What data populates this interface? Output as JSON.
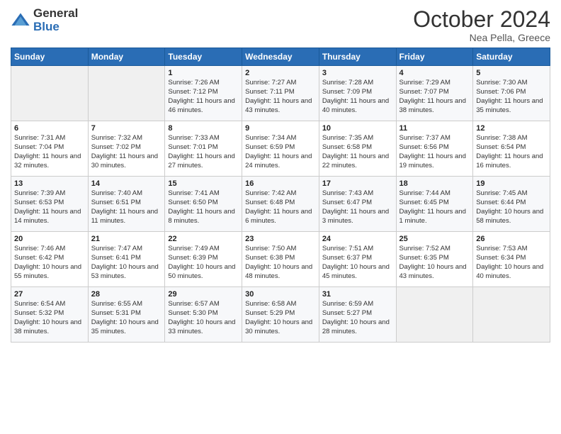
{
  "logo": {
    "general": "General",
    "blue": "Blue"
  },
  "title": "October 2024",
  "subtitle": "Nea Pella, Greece",
  "days_header": [
    "Sunday",
    "Monday",
    "Tuesday",
    "Wednesday",
    "Thursday",
    "Friday",
    "Saturday"
  ],
  "weeks": [
    [
      {
        "day": "",
        "sunrise": "",
        "sunset": "",
        "daylight": ""
      },
      {
        "day": "",
        "sunrise": "",
        "sunset": "",
        "daylight": ""
      },
      {
        "day": "1",
        "sunrise": "Sunrise: 7:26 AM",
        "sunset": "Sunset: 7:12 PM",
        "daylight": "Daylight: 11 hours and 46 minutes."
      },
      {
        "day": "2",
        "sunrise": "Sunrise: 7:27 AM",
        "sunset": "Sunset: 7:11 PM",
        "daylight": "Daylight: 11 hours and 43 minutes."
      },
      {
        "day": "3",
        "sunrise": "Sunrise: 7:28 AM",
        "sunset": "Sunset: 7:09 PM",
        "daylight": "Daylight: 11 hours and 40 minutes."
      },
      {
        "day": "4",
        "sunrise": "Sunrise: 7:29 AM",
        "sunset": "Sunset: 7:07 PM",
        "daylight": "Daylight: 11 hours and 38 minutes."
      },
      {
        "day": "5",
        "sunrise": "Sunrise: 7:30 AM",
        "sunset": "Sunset: 7:06 PM",
        "daylight": "Daylight: 11 hours and 35 minutes."
      }
    ],
    [
      {
        "day": "6",
        "sunrise": "Sunrise: 7:31 AM",
        "sunset": "Sunset: 7:04 PM",
        "daylight": "Daylight: 11 hours and 32 minutes."
      },
      {
        "day": "7",
        "sunrise": "Sunrise: 7:32 AM",
        "sunset": "Sunset: 7:02 PM",
        "daylight": "Daylight: 11 hours and 30 minutes."
      },
      {
        "day": "8",
        "sunrise": "Sunrise: 7:33 AM",
        "sunset": "Sunset: 7:01 PM",
        "daylight": "Daylight: 11 hours and 27 minutes."
      },
      {
        "day": "9",
        "sunrise": "Sunrise: 7:34 AM",
        "sunset": "Sunset: 6:59 PM",
        "daylight": "Daylight: 11 hours and 24 minutes."
      },
      {
        "day": "10",
        "sunrise": "Sunrise: 7:35 AM",
        "sunset": "Sunset: 6:58 PM",
        "daylight": "Daylight: 11 hours and 22 minutes."
      },
      {
        "day": "11",
        "sunrise": "Sunrise: 7:37 AM",
        "sunset": "Sunset: 6:56 PM",
        "daylight": "Daylight: 11 hours and 19 minutes."
      },
      {
        "day": "12",
        "sunrise": "Sunrise: 7:38 AM",
        "sunset": "Sunset: 6:54 PM",
        "daylight": "Daylight: 11 hours and 16 minutes."
      }
    ],
    [
      {
        "day": "13",
        "sunrise": "Sunrise: 7:39 AM",
        "sunset": "Sunset: 6:53 PM",
        "daylight": "Daylight: 11 hours and 14 minutes."
      },
      {
        "day": "14",
        "sunrise": "Sunrise: 7:40 AM",
        "sunset": "Sunset: 6:51 PM",
        "daylight": "Daylight: 11 hours and 11 minutes."
      },
      {
        "day": "15",
        "sunrise": "Sunrise: 7:41 AM",
        "sunset": "Sunset: 6:50 PM",
        "daylight": "Daylight: 11 hours and 8 minutes."
      },
      {
        "day": "16",
        "sunrise": "Sunrise: 7:42 AM",
        "sunset": "Sunset: 6:48 PM",
        "daylight": "Daylight: 11 hours and 6 minutes."
      },
      {
        "day": "17",
        "sunrise": "Sunrise: 7:43 AM",
        "sunset": "Sunset: 6:47 PM",
        "daylight": "Daylight: 11 hours and 3 minutes."
      },
      {
        "day": "18",
        "sunrise": "Sunrise: 7:44 AM",
        "sunset": "Sunset: 6:45 PM",
        "daylight": "Daylight: 11 hours and 1 minute."
      },
      {
        "day": "19",
        "sunrise": "Sunrise: 7:45 AM",
        "sunset": "Sunset: 6:44 PM",
        "daylight": "Daylight: 10 hours and 58 minutes."
      }
    ],
    [
      {
        "day": "20",
        "sunrise": "Sunrise: 7:46 AM",
        "sunset": "Sunset: 6:42 PM",
        "daylight": "Daylight: 10 hours and 55 minutes."
      },
      {
        "day": "21",
        "sunrise": "Sunrise: 7:47 AM",
        "sunset": "Sunset: 6:41 PM",
        "daylight": "Daylight: 10 hours and 53 minutes."
      },
      {
        "day": "22",
        "sunrise": "Sunrise: 7:49 AM",
        "sunset": "Sunset: 6:39 PM",
        "daylight": "Daylight: 10 hours and 50 minutes."
      },
      {
        "day": "23",
        "sunrise": "Sunrise: 7:50 AM",
        "sunset": "Sunset: 6:38 PM",
        "daylight": "Daylight: 10 hours and 48 minutes."
      },
      {
        "day": "24",
        "sunrise": "Sunrise: 7:51 AM",
        "sunset": "Sunset: 6:37 PM",
        "daylight": "Daylight: 10 hours and 45 minutes."
      },
      {
        "day": "25",
        "sunrise": "Sunrise: 7:52 AM",
        "sunset": "Sunset: 6:35 PM",
        "daylight": "Daylight: 10 hours and 43 minutes."
      },
      {
        "day": "26",
        "sunrise": "Sunrise: 7:53 AM",
        "sunset": "Sunset: 6:34 PM",
        "daylight": "Daylight: 10 hours and 40 minutes."
      }
    ],
    [
      {
        "day": "27",
        "sunrise": "Sunrise: 6:54 AM",
        "sunset": "Sunset: 5:32 PM",
        "daylight": "Daylight: 10 hours and 38 minutes."
      },
      {
        "day": "28",
        "sunrise": "Sunrise: 6:55 AM",
        "sunset": "Sunset: 5:31 PM",
        "daylight": "Daylight: 10 hours and 35 minutes."
      },
      {
        "day": "29",
        "sunrise": "Sunrise: 6:57 AM",
        "sunset": "Sunset: 5:30 PM",
        "daylight": "Daylight: 10 hours and 33 minutes."
      },
      {
        "day": "30",
        "sunrise": "Sunrise: 6:58 AM",
        "sunset": "Sunset: 5:29 PM",
        "daylight": "Daylight: 10 hours and 30 minutes."
      },
      {
        "day": "31",
        "sunrise": "Sunrise: 6:59 AM",
        "sunset": "Sunset: 5:27 PM",
        "daylight": "Daylight: 10 hours and 28 minutes."
      },
      {
        "day": "",
        "sunrise": "",
        "sunset": "",
        "daylight": ""
      },
      {
        "day": "",
        "sunrise": "",
        "sunset": "",
        "daylight": ""
      }
    ]
  ]
}
